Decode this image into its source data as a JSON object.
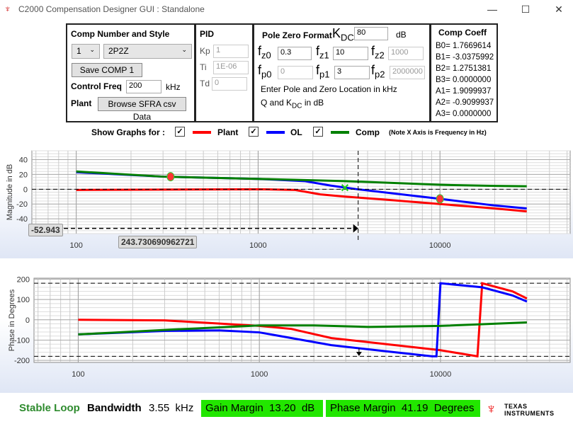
{
  "window": {
    "title": "C2000 Compensation Designer GUI : Standalone"
  },
  "comp": {
    "heading": "Comp Number and Style",
    "number": "1",
    "style": "2P2Z",
    "save_label": "Save COMP 1",
    "control_freq_label": "Control Freq",
    "control_freq": "200",
    "control_freq_unit": "kHz",
    "plant_label": "Plant",
    "browse_label": "Browse SFRA csv Data"
  },
  "pid": {
    "heading": "PID",
    "kp_label": "Kp",
    "kp": "1",
    "ti_label": "Ti",
    "ti": "1E-06",
    "td_label": "Td",
    "td": "0"
  },
  "pz": {
    "heading": "Pole Zero Format",
    "kdc_label": "K",
    "kdc_sub": "DC",
    "kdc": "80",
    "kdc_unit": "dB",
    "fz0": "0.3",
    "fz1": "10",
    "fz2": "1000",
    "fp0": "0",
    "fp1": "3",
    "fp2": "2000000",
    "note1": "Enter Pole and Zero Location in kHz",
    "note2a": "Q and K",
    "note2sub": "DC",
    "note2b": " in dB"
  },
  "coeff": {
    "heading": "Comp Coeff",
    "lines": [
      "B0= 1.7669614",
      "B1= -3.0375992",
      "B2= 1.2751381",
      "B3= 0.0000000",
      "A1= 1.9099937",
      "A2= -0.9099937",
      "A3= 0.0000000"
    ]
  },
  "graphs": {
    "label": "Show Graphs for :",
    "plant": "Plant",
    "ol": "OL",
    "comp": "Comp",
    "note": "(Note X Axis is Frequency in Hz)",
    "plant_checked": true,
    "ol_checked": true,
    "comp_checked": true
  },
  "colors": {
    "plant": "#ff0000",
    "ol": "#0000ff",
    "comp": "#008000",
    "margin_bg": "#22e600",
    "stable": "#2e8b2e"
  },
  "chart_data": [
    {
      "type": "line",
      "ylabel": "Magnitude in dB",
      "xscale": "log",
      "xlim": [
        57,
        52000
      ],
      "ylim": [
        -60,
        52
      ],
      "xticks": [
        100,
        1000,
        10000
      ],
      "yticks": [
        40,
        20,
        0,
        -20,
        -40
      ],
      "series": [
        {
          "name": "Plant",
          "color": "#ff0000",
          "x": [
            100,
            1000,
            1600,
            2200,
            3000,
            5000,
            10000,
            20000,
            30000
          ],
          "y": [
            -1,
            0,
            -1,
            -7,
            -10,
            -14,
            -20,
            -26,
            -30
          ]
        },
        {
          "name": "OL",
          "color": "#0000ff",
          "x": [
            100,
            300,
            1000,
            1800,
            2500,
            3500,
            10000,
            20000,
            30000
          ],
          "y": [
            23,
            17,
            14,
            11,
            5,
            0,
            -13,
            -22,
            -26
          ]
        },
        {
          "name": "Comp",
          "color": "#008000",
          "x": [
            100,
            300,
            1000,
            3000,
            10000,
            20000,
            30000
          ],
          "y": [
            24,
            17,
            14,
            11,
            6,
            4.5,
            4
          ]
        }
      ],
      "markers": [
        {
          "x": 330,
          "y": 17,
          "kind": "dot"
        },
        {
          "x": 3000,
          "y": 2,
          "kind": "x"
        },
        {
          "x": 10000,
          "y": -13,
          "kind": "dot"
        }
      ],
      "cursor_x": 3550,
      "cursor_y": -52.943,
      "cursor_y_label": "-52.943",
      "cursor_x_label": "243.730690962721"
    },
    {
      "type": "line",
      "ylabel": "Phase in Degrees",
      "xscale": "log",
      "xlim": [
        57,
        52000
      ],
      "ylim": [
        -210,
        205
      ],
      "xticks": [
        100,
        1000,
        10000
      ],
      "yticks": [
        200,
        100,
        0,
        -100,
        -200
      ],
      "series": [
        {
          "name": "Plant",
          "color": "#ff0000",
          "x": [
            100,
            300,
            1000,
            1500,
            2500,
            4000,
            10000,
            16000,
            16001,
            17000,
            25000,
            30000
          ],
          "y": [
            0,
            -3,
            -30,
            -45,
            -90,
            -110,
            -150,
            -180,
            -180,
            180,
            140,
            105
          ]
        },
        {
          "name": "OL",
          "color": "#0000ff",
          "x": [
            100,
            300,
            600,
            1000,
            2500,
            5000,
            9000,
            9500,
            10000,
            17000,
            25000,
            30000
          ],
          "y": [
            -72,
            -55,
            -52,
            -62,
            -125,
            -155,
            -180,
            -180,
            180,
            160,
            120,
            90
          ]
        },
        {
          "name": "Comp",
          "color": "#008000",
          "x": [
            100,
            300,
            1000,
            2000,
            4000,
            10000,
            30000
          ],
          "y": [
            -72,
            -50,
            -28,
            -28,
            -35,
            -30,
            -13
          ]
        }
      ],
      "hlines": [
        180,
        -180
      ],
      "arrow_x": 3550
    }
  ],
  "status": {
    "stable": "Stable Loop",
    "bw_label": "Bandwidth",
    "bw": "3.55",
    "bw_unit": "kHz",
    "gm_label": "Gain Margin",
    "gm": "13.20",
    "gm_unit": "dB",
    "pm_label": "Phase Margin",
    "pm": "41.19",
    "pm_unit": "Degrees",
    "logo": "TEXAS INSTRUMENTS"
  }
}
